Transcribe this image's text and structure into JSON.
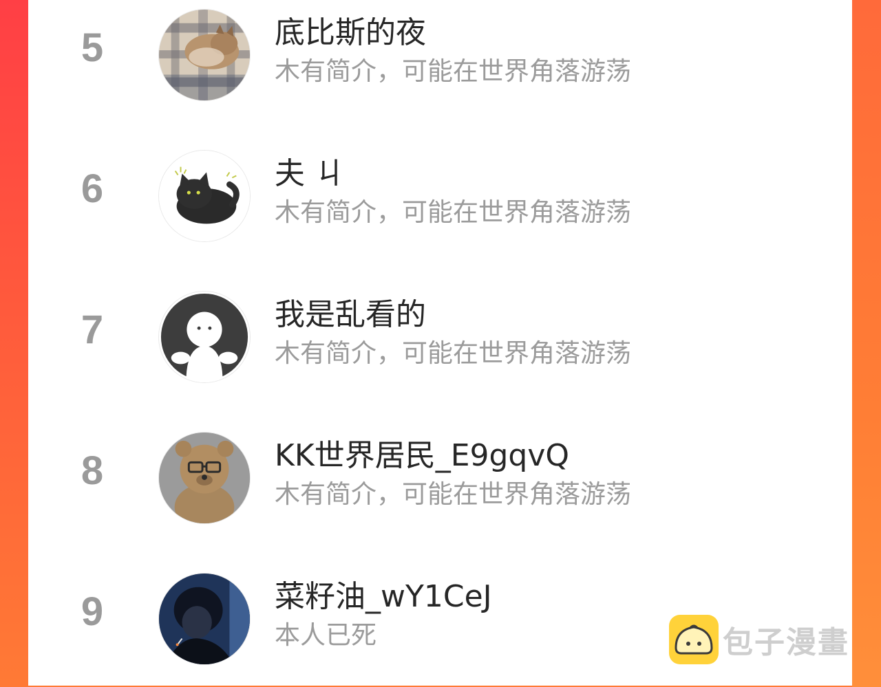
{
  "ranking": [
    {
      "rank": "5",
      "name": "底比斯的夜",
      "bio": "木有简介，可能在世界角落游荡",
      "avatar": "cat-on-plaid-avatar"
    },
    {
      "rank": "6",
      "name": "夫 ㄐ",
      "bio": "木有简介，可能在世界角落游荡",
      "avatar": "black-cat-sticker-avatar"
    },
    {
      "rank": "7",
      "name": "我是乱看的",
      "bio": "木有简介，可能在世界角落游荡",
      "avatar": "default-ghost-avatar"
    },
    {
      "rank": "8",
      "name": "KK世界居民_E9gqvQ",
      "bio": "木有简介，可能在世界角落游荡",
      "avatar": "teddy-bear-avatar"
    },
    {
      "rank": "9",
      "name": "菜籽油_wY1CeJ",
      "bio": "本人已死",
      "avatar": "dark-portrait-avatar"
    }
  ],
  "watermark": {
    "text": "包子漫畫",
    "logo": "bun-mascot-icon"
  },
  "colors": {
    "background_left": "#ff3f45",
    "background_right": "#ff7e35",
    "rank": "#9a9a9a",
    "name": "#262626",
    "bio": "#9b9b9b",
    "logo_yellow": "#ffd23a"
  }
}
